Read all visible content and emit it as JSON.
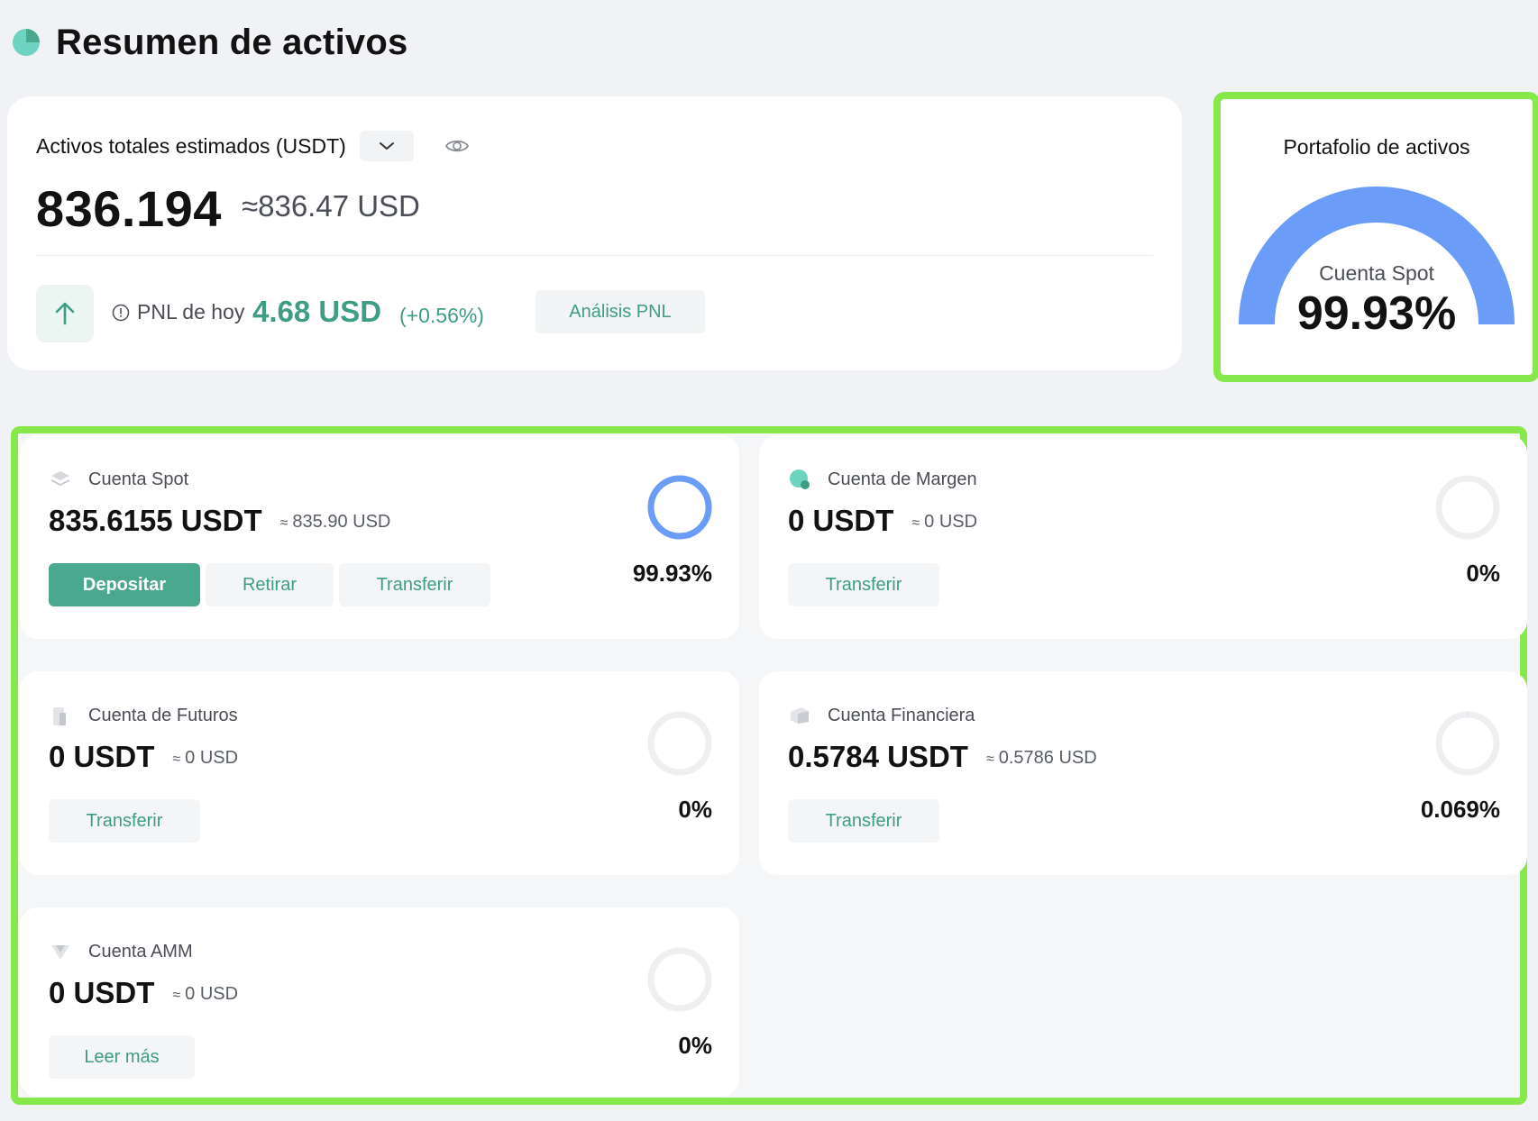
{
  "page": {
    "title": "Resumen de activos"
  },
  "colors": {
    "accent": "#3f9d86",
    "gauge": "#6b9cf7",
    "highlight": "#86e84a"
  },
  "summary": {
    "label": "Activos totales estimados (USDT)",
    "total": "836.194",
    "total_usd": "≈836.47 USD",
    "pnl_label": "PNL de hoy",
    "pnl_value": "4.68 USD",
    "pnl_pct": "(+0.56%)",
    "analysis_button": "Análisis PNL",
    "icons": {
      "dropdown": "chevron-down-icon",
      "eye": "eye-icon",
      "trend": "arrow-up-icon",
      "info": "info-icon"
    }
  },
  "portfolio": {
    "title": "Portafolio de activos",
    "account": "Cuenta Spot",
    "pct": "99.93%",
    "share": 0.9993
  },
  "accounts": [
    {
      "name": "Cuenta Spot",
      "balance": "835.6155 USDT",
      "approx": "≈",
      "usd": "835.90 USD",
      "pct": "99.93%",
      "share": 0.9993,
      "buttons": [
        "Depositar",
        "Retirar",
        "Transferir"
      ]
    },
    {
      "name": "Cuenta de Margen",
      "balance": "0 USDT",
      "approx": "≈",
      "usd": "0 USD",
      "pct": "0%",
      "share": 0,
      "buttons": [
        "Transferir"
      ]
    },
    {
      "name": "Cuenta de Futuros",
      "balance": "0 USDT",
      "approx": "≈",
      "usd": "0 USD",
      "pct": "0%",
      "share": 0,
      "buttons": [
        "Transferir"
      ]
    },
    {
      "name": "Cuenta Financiera",
      "balance": "0.5784 USDT",
      "approx": "≈",
      "usd": "0.5786 USD",
      "pct": "0.069%",
      "share": 0.00069,
      "buttons": [
        "Transferir"
      ]
    },
    {
      "name": "Cuenta AMM",
      "balance": "0 USDT",
      "approx": "≈",
      "usd": "0 USD",
      "pct": "0%",
      "share": 0,
      "buttons": [
        "Leer más"
      ]
    }
  ]
}
